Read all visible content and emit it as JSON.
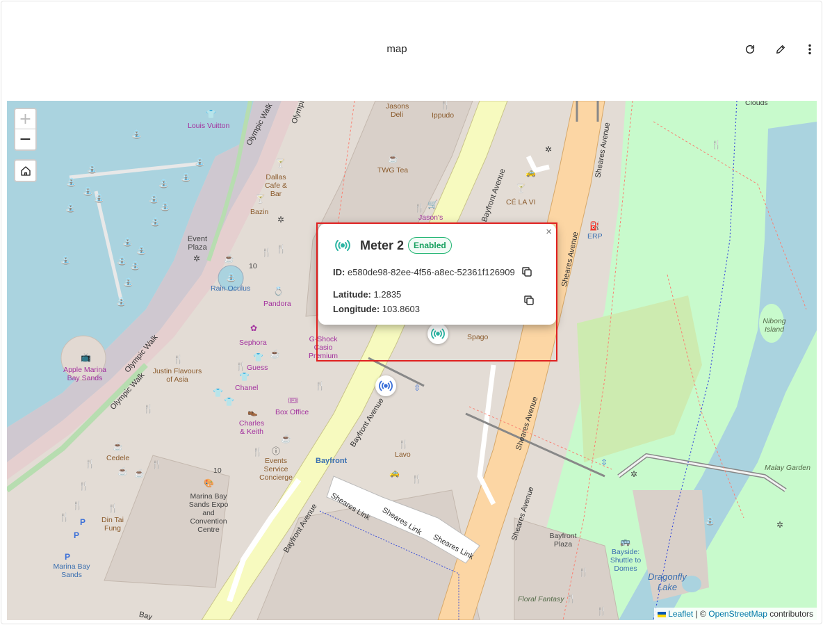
{
  "header": {
    "title": "map",
    "refresh_icon": "refresh-icon",
    "edit_icon": "pencil-icon",
    "more_icon": "more-vertical-icon"
  },
  "map_controls": {
    "zoom_in": "+",
    "zoom_out": "−",
    "home_icon": "home-icon"
  },
  "attribution": {
    "leaflet": "Leaflet",
    "separator": "| ©",
    "osm": "OpenStreetMap",
    "suffix": "contributors"
  },
  "popup": {
    "sensor_icon": "sensor-icon",
    "name": "Meter 2",
    "status": "Enabled",
    "id_label": "ID:",
    "id_value": "e580de98-82ee-4f56-a8ec-52361f126909",
    "lat_label": "Latitude:",
    "lat_value": "1.2835",
    "lng_label": "Longitude:",
    "lng_value": "103.8603",
    "close": "×"
  },
  "map_labels": {
    "louis_vuitton": "Louis Vuitton",
    "olympic_walk": "Olympic Walk",
    "olympic": "Olympic",
    "jasons_deli": "Jasons Deli",
    "ippudo": "Ippudo",
    "twg_tea": "TWG Tea",
    "dallas": "Dallas Cafe & Bar",
    "bazin": "Bazin",
    "jasons": "Jason's",
    "ce_la_vi": "CÉ LA VI",
    "event_plaza": "Event Plaza",
    "rain_oculus": "Rain Oculus",
    "pandora": "Pandora",
    "sephora": "Sephora",
    "gshock": "G-Shock Casio Premium",
    "guess": "Guess",
    "chanel": "Chanel",
    "justin": "Justin Flavours of Asia",
    "apple": "Apple Marina Bay Sands",
    "box_office": "Box Office",
    "charles": "Charles & Keith",
    "cedele": "Cedele",
    "events": "Events Service Concierge",
    "mbs_expo": "Marina Bay Sands Expo and Convention Centre",
    "din_tai": "Din Tai Fung",
    "marina_bay_sands": "Marina Bay Sands",
    "bayfront": "Bayfront",
    "bayfront_avenue": "Bayfront Avenue",
    "sheares_avenue": "Sheares Avenue",
    "sheares_link": "Sheares Link",
    "lavo": "Lavo",
    "spago": "Spago",
    "erp": "ERP",
    "clouds": "Clouds",
    "nibong": "Nibong Island",
    "malay_garden": "Malay Garden",
    "bayfront_plaza": "Bayfront Plaza",
    "bayside": "Bayside: Shuttle to Domes",
    "dragonfly": "Dragonfly Lake",
    "floral": "Floral Fantasy",
    "num_10": "10",
    "baylabel": "Bay"
  },
  "colors": {
    "water": "#aad3df",
    "land": "#e3dcd5",
    "park": "#c8facc",
    "primary_road": "#fcd6a4",
    "secondary_road": "#f7fabf",
    "selection": "#e02020",
    "sensor": "#2bb5a3",
    "sensor_blue": "#3a6fd8"
  }
}
